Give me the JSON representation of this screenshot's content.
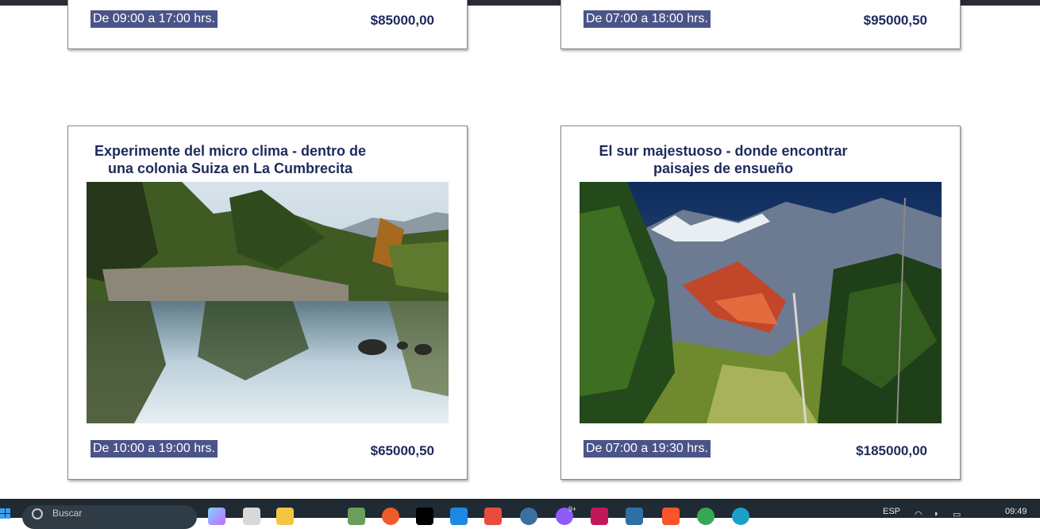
{
  "cards": [
    {
      "hours": "De 09:00 a 17:00 hrs.",
      "price": "$85000,00"
    },
    {
      "hours": "De 07:00 a 18:00 hrs.",
      "price": "$95000,50"
    },
    {
      "title_line1": "Experimente del micro clima - dentro de",
      "title_line2": "una colonia Suiza en La Cumbrecita",
      "hours": "De 10:00 a 19:00 hrs.",
      "price": "$65000,50"
    },
    {
      "title_line1": "El sur majestuoso - donde encontrar",
      "title_line2": "paisajes de ensueño",
      "hours": "De 07:00 a 19:30 hrs.",
      "price": "$185000,00"
    }
  ],
  "taskbar": {
    "search_placeholder": "Buscar",
    "language": "ESP",
    "time": "09:49",
    "notification_badge": "9+"
  },
  "colors": {
    "title": "#1d2a5c",
    "hours_bg": "#4b5488",
    "taskbar": "#1f2a33"
  }
}
